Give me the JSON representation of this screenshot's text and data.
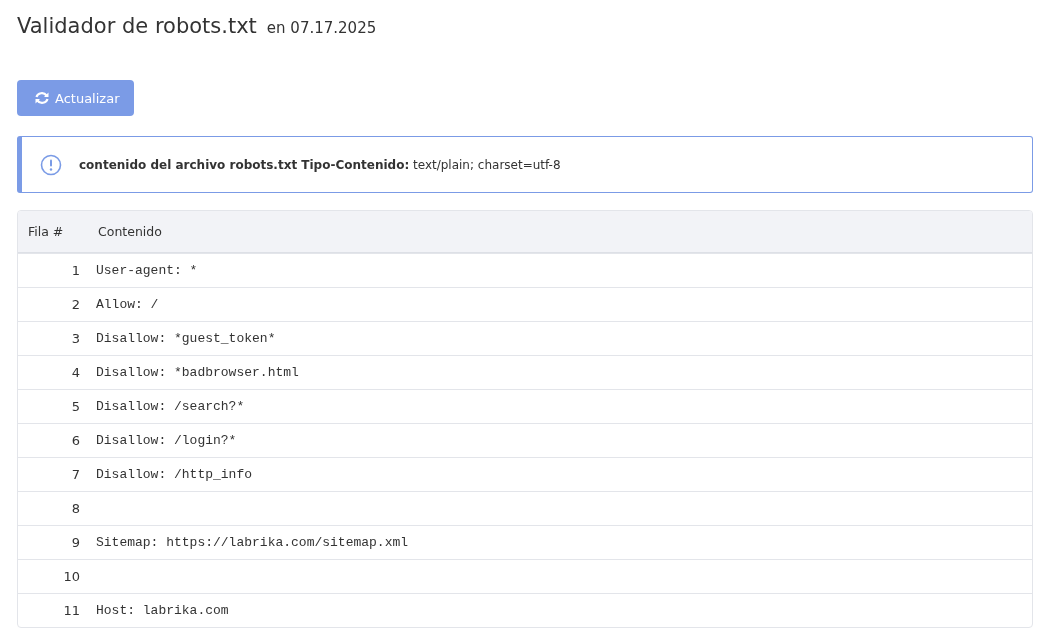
{
  "header": {
    "title": "Validador de robots.txt",
    "date": "en 07.17.2025"
  },
  "refresh_button": {
    "label": "Actualizar"
  },
  "alert": {
    "text": "**contenido del archivo robots.txt Tipo-Contenido:** text/plain; charset=utf-8"
  },
  "table": {
    "columns": [
      "Fila #",
      "Contenido"
    ],
    "rows": [
      {
        "number": "1",
        "content": "User-agent: *"
      },
      {
        "number": "2",
        "content": "Allow: /"
      },
      {
        "number": "3",
        "content": "Disallow: *guest_token*"
      },
      {
        "number": "4",
        "content": "Disallow: *badbrowser.html"
      },
      {
        "number": "5",
        "content": "Disallow: /search?*"
      },
      {
        "number": "6",
        "content": "Disallow: /login?*"
      },
      {
        "number": "7",
        "content": "Disallow: /http_info"
      },
      {
        "number": "8"
      },
      {
        "number": "9",
        "content": "Sitemap: https://labrika.com/sitemap.xml"
      },
      {
        "number": "10"
      },
      {
        "number": "11",
        "content": "Host: labrika.com"
      }
    ]
  }
}
